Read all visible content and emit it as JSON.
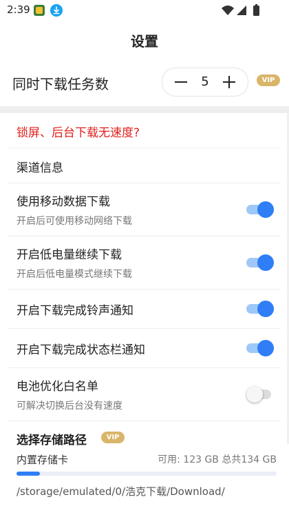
{
  "status_bar": {
    "time": "2:39"
  },
  "header": {
    "title": "设置"
  },
  "task_count": {
    "label": "同时下载任务数",
    "value": "5",
    "vip": "VIP"
  },
  "rows": {
    "lock_screen": {
      "title": "锁屏、后台下载无速度?"
    },
    "channel": {
      "title": "渠道信息"
    },
    "mobile_data": {
      "title": "使用移动数据下载",
      "subtitle": "开启后可使用移动网络下载",
      "enabled": true
    },
    "low_power": {
      "title": "开启低电量继续下载",
      "subtitle": "开启后低电量模式继续下载",
      "enabled": true
    },
    "ringtone": {
      "title": "开启下载完成铃声通知",
      "enabled": true
    },
    "status_bar_notify": {
      "title": "开启下载完成状态栏通知",
      "enabled": true
    },
    "battery": {
      "title": "电池优化白名单",
      "subtitle": "可解决切换后台没有速度",
      "enabled": false
    }
  },
  "storage": {
    "title": "选择存储路径",
    "vip": "VIP",
    "internal_label": "内置存储卡",
    "available": "可用: 123 GB 总共134 GB",
    "used_fraction": 0.09,
    "path": "/storage/emulated/0/浩克下载/Download/"
  },
  "colors": {
    "accent": "#2f7ef5",
    "warning_text": "#e0201c",
    "vip_gold": "#d9b56a"
  }
}
